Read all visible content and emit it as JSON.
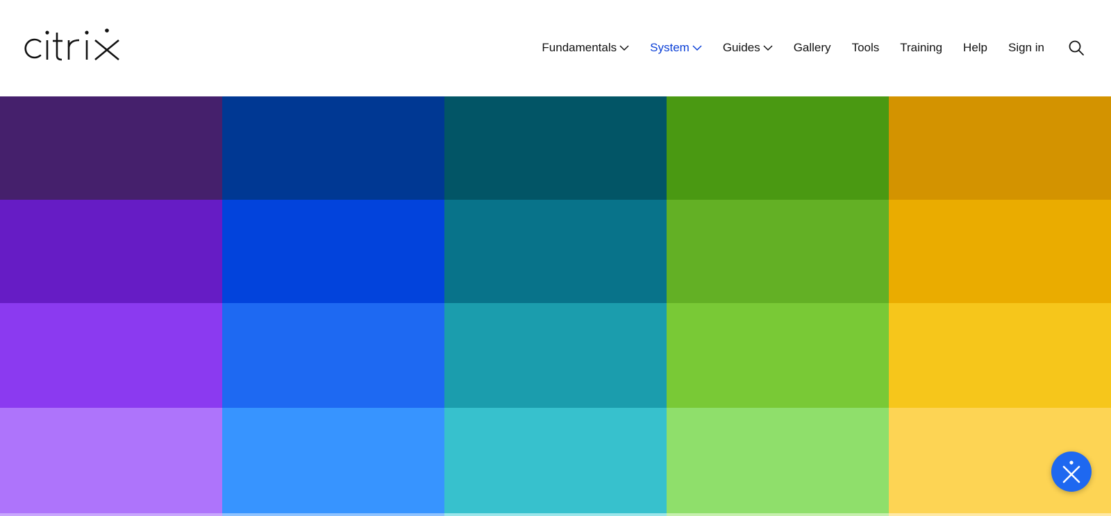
{
  "brand": {
    "logo_text": "citrix",
    "accent": "#0a3fd6"
  },
  "nav": {
    "items": [
      {
        "label": "Fundamentals",
        "has_dropdown": true,
        "active": false
      },
      {
        "label": "System",
        "has_dropdown": true,
        "active": true
      },
      {
        "label": "Guides",
        "has_dropdown": true,
        "active": false
      },
      {
        "label": "Gallery",
        "has_dropdown": false,
        "active": false
      },
      {
        "label": "Tools",
        "has_dropdown": false,
        "active": false
      },
      {
        "label": "Training",
        "has_dropdown": false,
        "active": false
      },
      {
        "label": "Help",
        "has_dropdown": false,
        "active": false
      },
      {
        "label": "Sign in",
        "has_dropdown": false,
        "active": false
      }
    ],
    "search_icon": "search-icon",
    "chevron_icon": "chevron-down-icon"
  },
  "palette": {
    "columns": [
      {
        "family": "purple",
        "colors": [
          "#45206c",
          "#661cc5",
          "#8b3af0",
          "#ae74fb",
          "#c9a6fd"
        ]
      },
      {
        "family": "blue",
        "colors": [
          "#003893",
          "#0243dc",
          "#1e69f2",
          "#3794ff",
          "#8fc3ff"
        ]
      },
      {
        "family": "teal",
        "colors": [
          "#025566",
          "#08738a",
          "#1b9dad",
          "#37c1cd",
          "#9be6ea"
        ]
      },
      {
        "family": "green",
        "colors": [
          "#4a9912",
          "#63b025",
          "#79c936",
          "#8fdf6b",
          "#c6f0ad"
        ]
      },
      {
        "family": "yellow",
        "colors": [
          "#d39300",
          "#eaac00",
          "#f6c61b",
          "#fdd454",
          "#ffe9a5"
        ]
      }
    ]
  },
  "fab": {
    "icon": "citrix-x-icon",
    "color": "#1e68f0"
  }
}
